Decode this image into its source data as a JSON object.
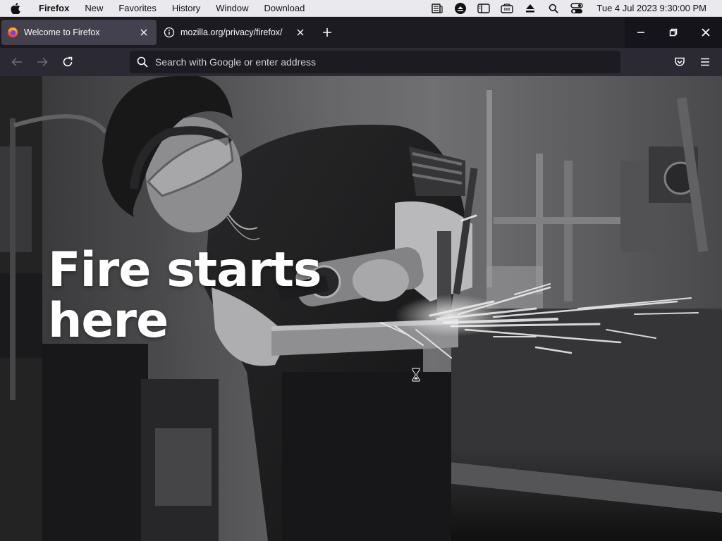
{
  "menubar": {
    "app_name": "Firefox",
    "items": [
      "New",
      "Favorites",
      "History",
      "Window",
      "Download"
    ],
    "clock": "Tue 4 Jul 2023  9:30:00 PM",
    "status_icons": [
      "news-icon",
      "account-circle-icon",
      "sidebar-icon",
      "cloud-drive-icon",
      "eject-icon",
      "search-icon",
      "control-center-icon"
    ]
  },
  "tabs": [
    {
      "title": "Welcome to Firefox",
      "icon": "firefox-logo-icon",
      "active": true
    },
    {
      "title": "mozilla.org/privacy/firefox/",
      "icon": "info-icon",
      "active": false
    }
  ],
  "urlbar": {
    "placeholder": "Search with Google or enter address"
  },
  "hero": {
    "line1": "Fire starts",
    "line2": "here"
  },
  "colors": {
    "chrome_dark": "#1c1b22",
    "toolbar": "#2b2a33",
    "active_tab": "#42414d",
    "text_light": "#fbfbfe"
  }
}
